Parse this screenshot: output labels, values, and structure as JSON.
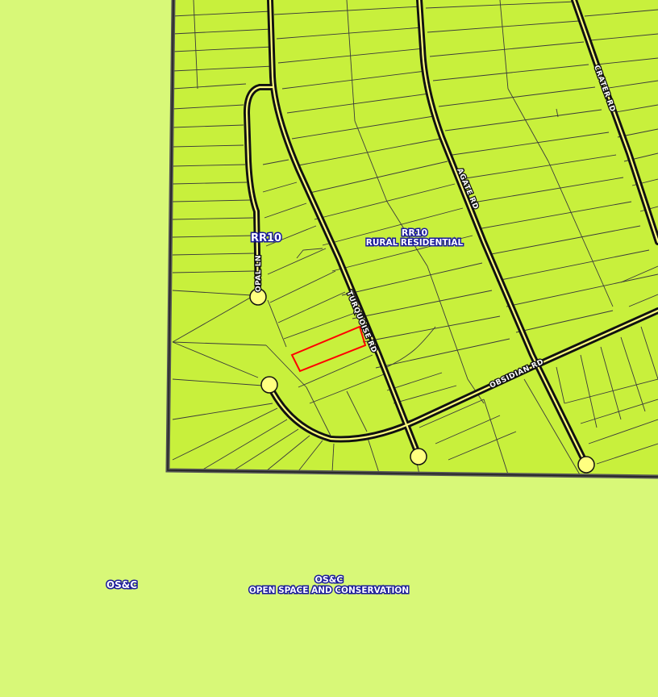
{
  "colors": {
    "open_space_background": "#d8f878",
    "residential_zone_fill": "#c8f03c",
    "parcel_line": "#3a3a3a",
    "road_casing": "#111111",
    "road_centerline": "#ffff80",
    "highlighted_parcel": "#ff0000",
    "zone_label_outline": "#1a1a9a"
  },
  "zones": {
    "rr10_west": {
      "code": "RR10"
    },
    "rr10_center": {
      "code": "RR10",
      "name": "RURAL RESIDENTIAL"
    },
    "osc_left": {
      "code": "OS&C"
    },
    "osc_center": {
      "code": "OS&C",
      "name": "OPEN SPACE AND CONSERVATION"
    }
  },
  "roads": {
    "opal": "OPAL LN",
    "turquoise": "TURQUOISE RD",
    "agate": "AGATE RD",
    "crater": "CRATER RD",
    "obsidian": "OBSIDIAN RD"
  },
  "highlighted_parcel": {
    "color": "#ff0000"
  }
}
